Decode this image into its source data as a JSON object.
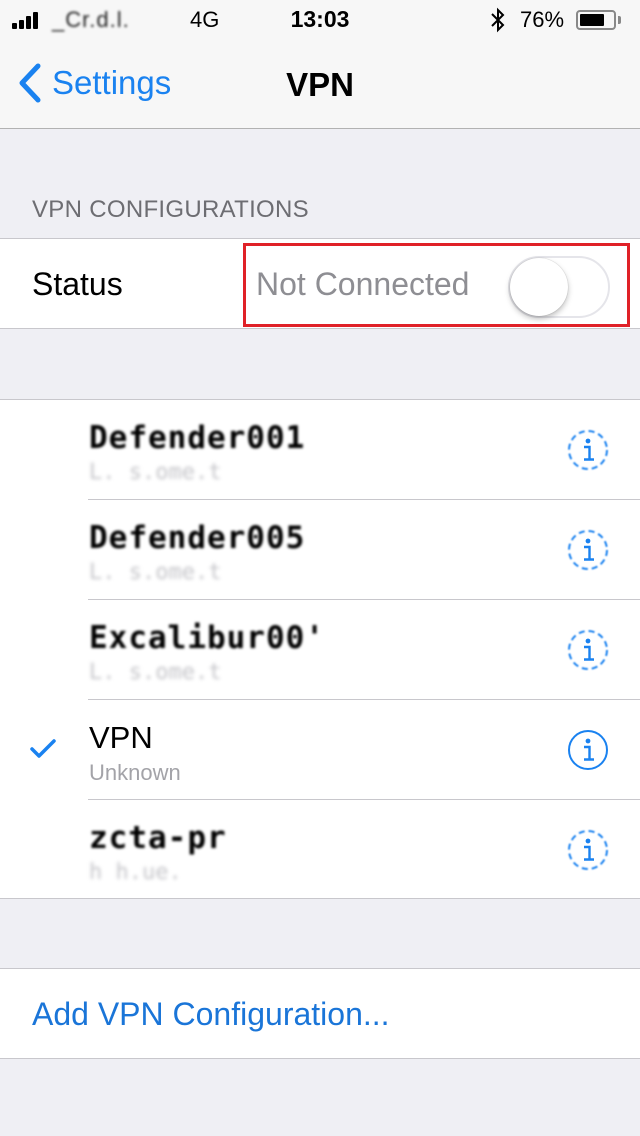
{
  "status_bar": {
    "carrier": "_Cr.d.l.",
    "network": "4G",
    "time": "13:03",
    "bluetooth_icon": "bluetooth-icon",
    "battery_text": "76%",
    "battery_level": 0.76
  },
  "nav": {
    "back_label": "Settings",
    "title": "VPN"
  },
  "section_header": "VPN CONFIGURATIONS",
  "status": {
    "label": "Status",
    "value": "Not Connected",
    "toggle_on": false
  },
  "vpn_list": [
    {
      "name": "Defender001",
      "subtitle": "L. s.ome.t",
      "selected": false,
      "info_icon": "info-icon",
      "obscured": true
    },
    {
      "name": "Defender005",
      "subtitle": "L. s.ome.t",
      "selected": false,
      "info_icon": "info-icon",
      "obscured": true
    },
    {
      "name": "Excalibur00'",
      "subtitle": "L. s.ome.t",
      "selected": false,
      "info_icon": "info-icon",
      "obscured": true
    },
    {
      "name": "VPN",
      "subtitle": "Unknown",
      "selected": true,
      "info_icon": "info-icon",
      "obscured": false
    },
    {
      "name": "zcta-pr",
      "subtitle": "h h.ue.",
      "selected": false,
      "info_icon": "info-icon",
      "obscured": true
    }
  ],
  "add_config_label": "Add VPN Configuration...",
  "colors": {
    "accent": "#1a82f0",
    "highlight_box": "#e02128",
    "group_background": "#efeff4"
  }
}
